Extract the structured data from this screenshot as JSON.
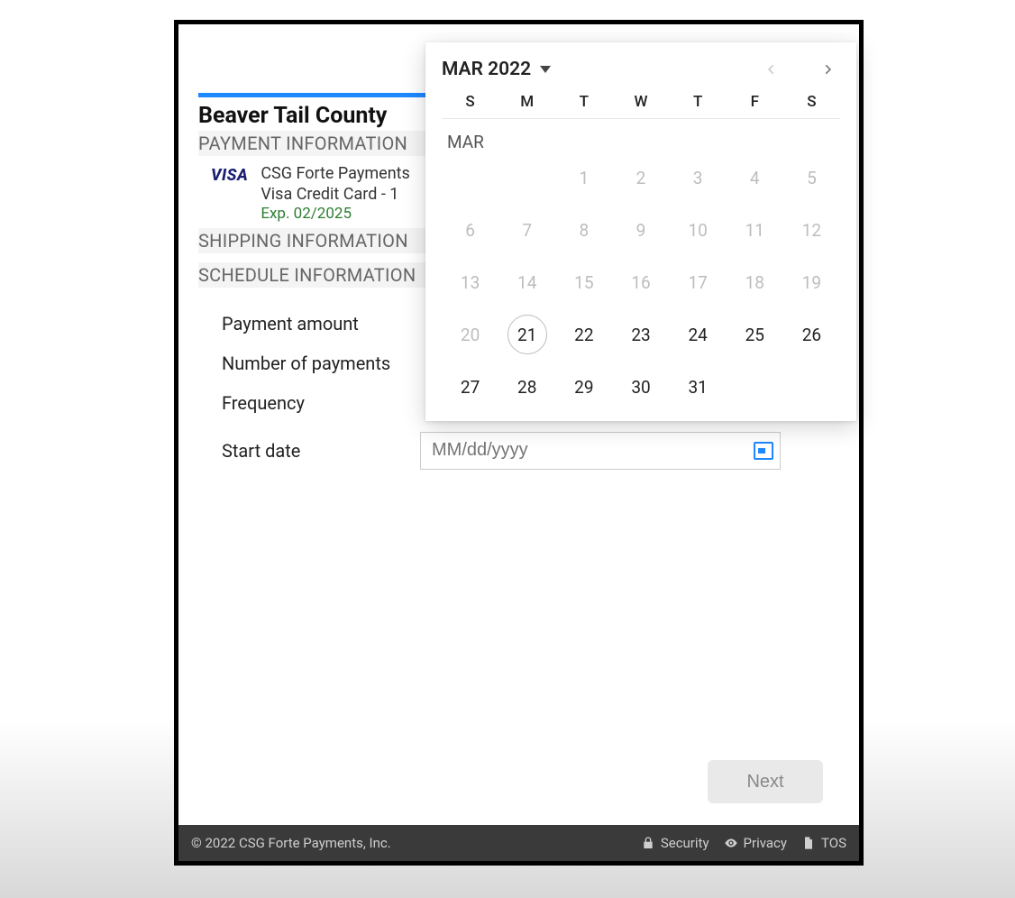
{
  "org_title": "Beaver Tail County",
  "sections": {
    "payment": "PAYMENT INFORMATION",
    "shipping": "SHIPPING INFORMATION",
    "schedule": "SCHEDULE INFORMATION"
  },
  "card": {
    "brand": "VISA",
    "line1": "CSG Forte Payments",
    "line2": "Visa Credit Card - 1",
    "expiry": "Exp. 02/2025"
  },
  "form": {
    "amount_label": "Payment amount",
    "count_label": "Number of payments",
    "frequency_label": "Frequency",
    "startdate_label": "Start date",
    "startdate_placeholder": "MM/dd/yyyy"
  },
  "next_label": "Next",
  "footer": {
    "copyright": "© 2022 CSG Forte Payments, Inc.",
    "links": {
      "security": "Security",
      "privacy": "Privacy",
      "tos": "TOS"
    }
  },
  "calendar": {
    "title": "MAR 2022",
    "month_short": "MAR",
    "dow": [
      "S",
      "M",
      "T",
      "W",
      "T",
      "F",
      "S"
    ],
    "leading_blanks": 2,
    "today": 21,
    "first_future": 21,
    "days_in_month": 31
  }
}
